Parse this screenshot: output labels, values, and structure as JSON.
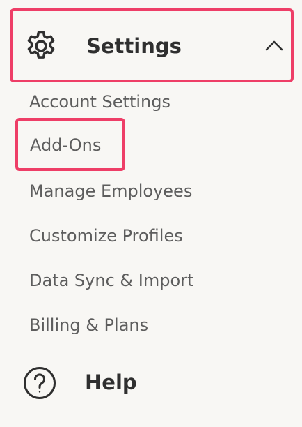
{
  "settings": {
    "title": "Settings",
    "icon": "gear-icon",
    "expanded": true,
    "collapse_icon": "chevron-up-icon",
    "highlight_color": "#ee3e67",
    "items": [
      {
        "label": "Account Settings"
      },
      {
        "label": "Add-Ons",
        "highlighted": true
      },
      {
        "label": "Manage Employees"
      },
      {
        "label": "Customize Profiles"
      },
      {
        "label": "Data Sync & Import"
      },
      {
        "label": "Billing & Plans"
      }
    ]
  },
  "help": {
    "label": "Help",
    "icon": "question-circle-icon"
  }
}
